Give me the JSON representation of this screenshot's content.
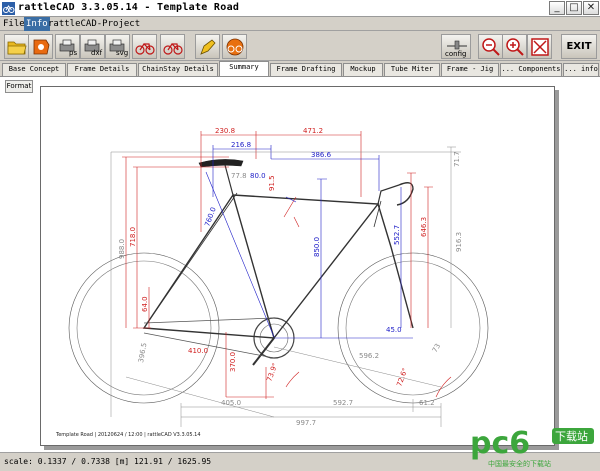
{
  "window": {
    "title": "rattleCAD  3.3.05.14 - Template Road",
    "min_glyph": "_",
    "max_glyph": "□",
    "close_glyph": "✕"
  },
  "menu": {
    "file": "File",
    "info": "Info",
    "project": "rattleCAD-Project"
  },
  "toolbar": {
    "ps_label": "ps",
    "dxf_label": "dxf",
    "svg_label": "svg",
    "config_label": "config",
    "exit_label": "EXIT"
  },
  "tabs": [
    {
      "label": "Base Concept"
    },
    {
      "label": "Frame Details"
    },
    {
      "label": "ChainStay Details"
    },
    {
      "label": "Summary"
    },
    {
      "label": "Frame Drafting"
    },
    {
      "label": "Mockup"
    },
    {
      "label": "Tube Miter"
    },
    {
      "label": "Frame - Jig"
    },
    {
      "label": "... Components"
    },
    {
      "label": "... info"
    }
  ],
  "active_tab": "Summary",
  "format_button": "Format",
  "drawing": {
    "dims": {
      "d230_8": "230.8",
      "d471_2": "471.2",
      "d216_8": "216.8",
      "d386_6": "386.6",
      "d77_8": "77.8",
      "d80": "80.0",
      "d91_5": "91.5",
      "d71_7": "71.7",
      "d718": "718.0",
      "d988": "988.0",
      "d760": "760.0",
      "d850": "850.0",
      "d552_7": "552.7",
      "d646_3": "646.3",
      "d916_3": "916.3",
      "d64": "64.0",
      "d396_5": "396.5",
      "d410": "410.0",
      "d370": "370.0",
      "d45": "45.0",
      "d596_2": "596.2",
      "d73_9": "73.9°",
      "d72_6": "72.6°",
      "d405": "405.0",
      "d592_7": "592.7",
      "d61_2": "61.2",
      "d997_7": "997.7",
      "d73": "73"
    },
    "footer": "Template Road  |  20120624 / 12:00  |  rattleCAD  V3.3.05.14"
  },
  "status": "scale: 0.1337 / 0.7338  [m]  121.91 / 1625.95",
  "watermark": {
    "logo": "pc6",
    "badge": "下载站",
    "slogan": "中国最安全的下载站"
  },
  "colors": {
    "red": "#d02020",
    "blue": "#2020c8",
    "gray": "#8a8a8a",
    "menu_highlight": "#3a6ea5",
    "watermark_green": "#3ca63c"
  }
}
